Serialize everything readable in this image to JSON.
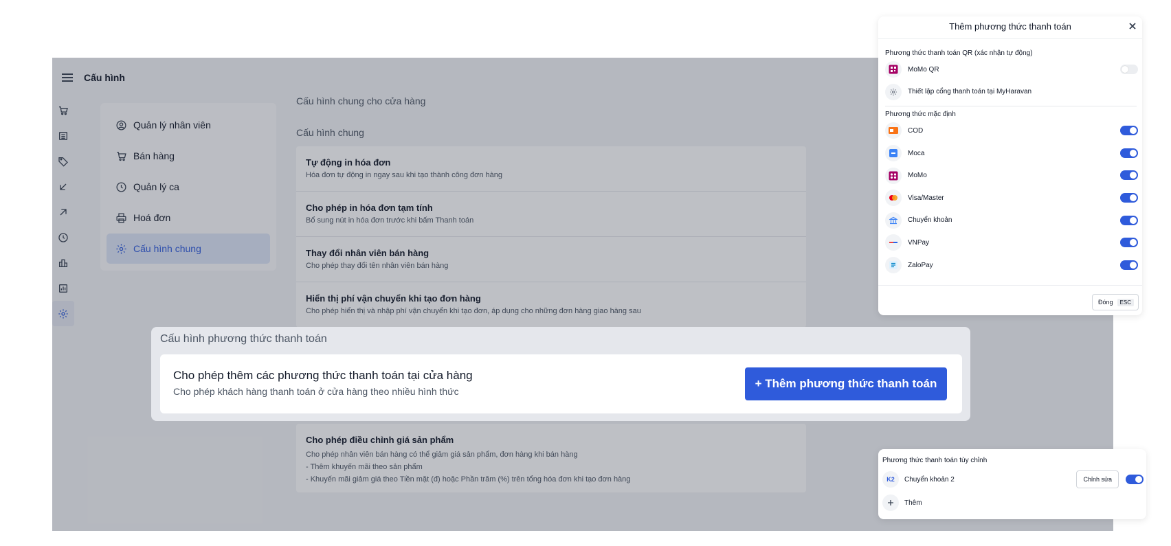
{
  "app": {
    "title": "Cấu hình"
  },
  "nav": {
    "items": [
      {
        "label": "Quản lý nhân viên",
        "icon": "user-circle-icon"
      },
      {
        "label": "Bán hàng",
        "icon": "cart-icon"
      },
      {
        "label": "Quản lý ca",
        "icon": "clock-icon"
      },
      {
        "label": "Hoá đơn",
        "icon": "printer-icon"
      },
      {
        "label": "Cấu hình chung",
        "icon": "gear-icon",
        "active": true
      }
    ]
  },
  "content": {
    "heading": "Cấu hình chung cho cửa hàng",
    "section": "Cấu hình chung",
    "settings": [
      {
        "title": "Tự động in hóa đơn",
        "desc": "Hóa đơn tự động in ngay sau khi tạo thành công đơn hàng"
      },
      {
        "title": "Cho phép in hóa đơn tạm tính",
        "desc": "Bổ sung nút in hóa đơn trước khi bấm Thanh toán"
      },
      {
        "title": "Thay đổi nhân viên bán hàng",
        "desc": "Cho phép thay đổi tên nhân viên bán hàng"
      },
      {
        "title": "Hiển thị phí vận chuyển khi tạo đơn hàng",
        "desc": "Cho phép hiển thị và nhập phí vận chuyển khi tạo đơn, áp dụng cho những đơn hàng giao hàng sau"
      }
    ],
    "price_adjust": {
      "title": "Cho phép điều chỉnh giá sản phẩm",
      "desc1": "Cho phép nhân viên bán hàng có thể giảm giá sản phẩm, đơn hàng khi bán hàng",
      "desc2": "- Thêm khuyến mãi theo sản phẩm",
      "desc3": "- Khuyến mãi giảm giá theo Tiền mặt (đ) hoặc Phần trăm (%) trên tổng hóa đơn khi tạo đơn hàng"
    }
  },
  "payment_config": {
    "title": "Cấu hình phương thức thanh toán",
    "item_title": "Cho phép thêm các phương thức thanh toán tại cửa hàng",
    "item_desc": "Cho phép khách hàng thanh toán ở cửa hàng theo nhiều hình thức",
    "add_button": "+ Thêm phương thức thanh toán",
    "accent": "#2f5bdb"
  },
  "modal": {
    "title": "Thêm phương thức thanh toán",
    "qr_section": "Phương thức thanh toán QR (xác nhận tự động)",
    "qr_methods": [
      {
        "label": "MoMo QR",
        "icon": "momo-qr-icon",
        "enabled": false
      },
      {
        "label": "Thiết lập cổng thanh toán tại MyHaravan",
        "icon": "gear-icon"
      }
    ],
    "default_section": "Phương thức mặc định",
    "default_methods": [
      {
        "label": "COD",
        "icon": "cod-icon",
        "enabled": true
      },
      {
        "label": "Moca",
        "icon": "moca-icon",
        "enabled": true
      },
      {
        "label": "MoMo",
        "icon": "momo-icon",
        "enabled": true
      },
      {
        "label": "Visa/Master",
        "icon": "mastercard-icon",
        "enabled": true
      },
      {
        "label": "Chuyển khoản",
        "icon": "bank-icon",
        "enabled": true
      },
      {
        "label": "VNPay",
        "icon": "vnpay-icon",
        "enabled": true
      },
      {
        "label": "ZaloPay",
        "icon": "zalopay-icon",
        "enabled": true
      }
    ],
    "close_label": "Đóng",
    "close_key": "ESC"
  },
  "custom": {
    "section": "Phương thức thanh toán tùy chỉnh",
    "method": {
      "badge": "K2",
      "label": "Chuyển khoản 2",
      "edit": "Chỉnh sửa",
      "enabled": true
    },
    "add_label": "Thêm"
  }
}
